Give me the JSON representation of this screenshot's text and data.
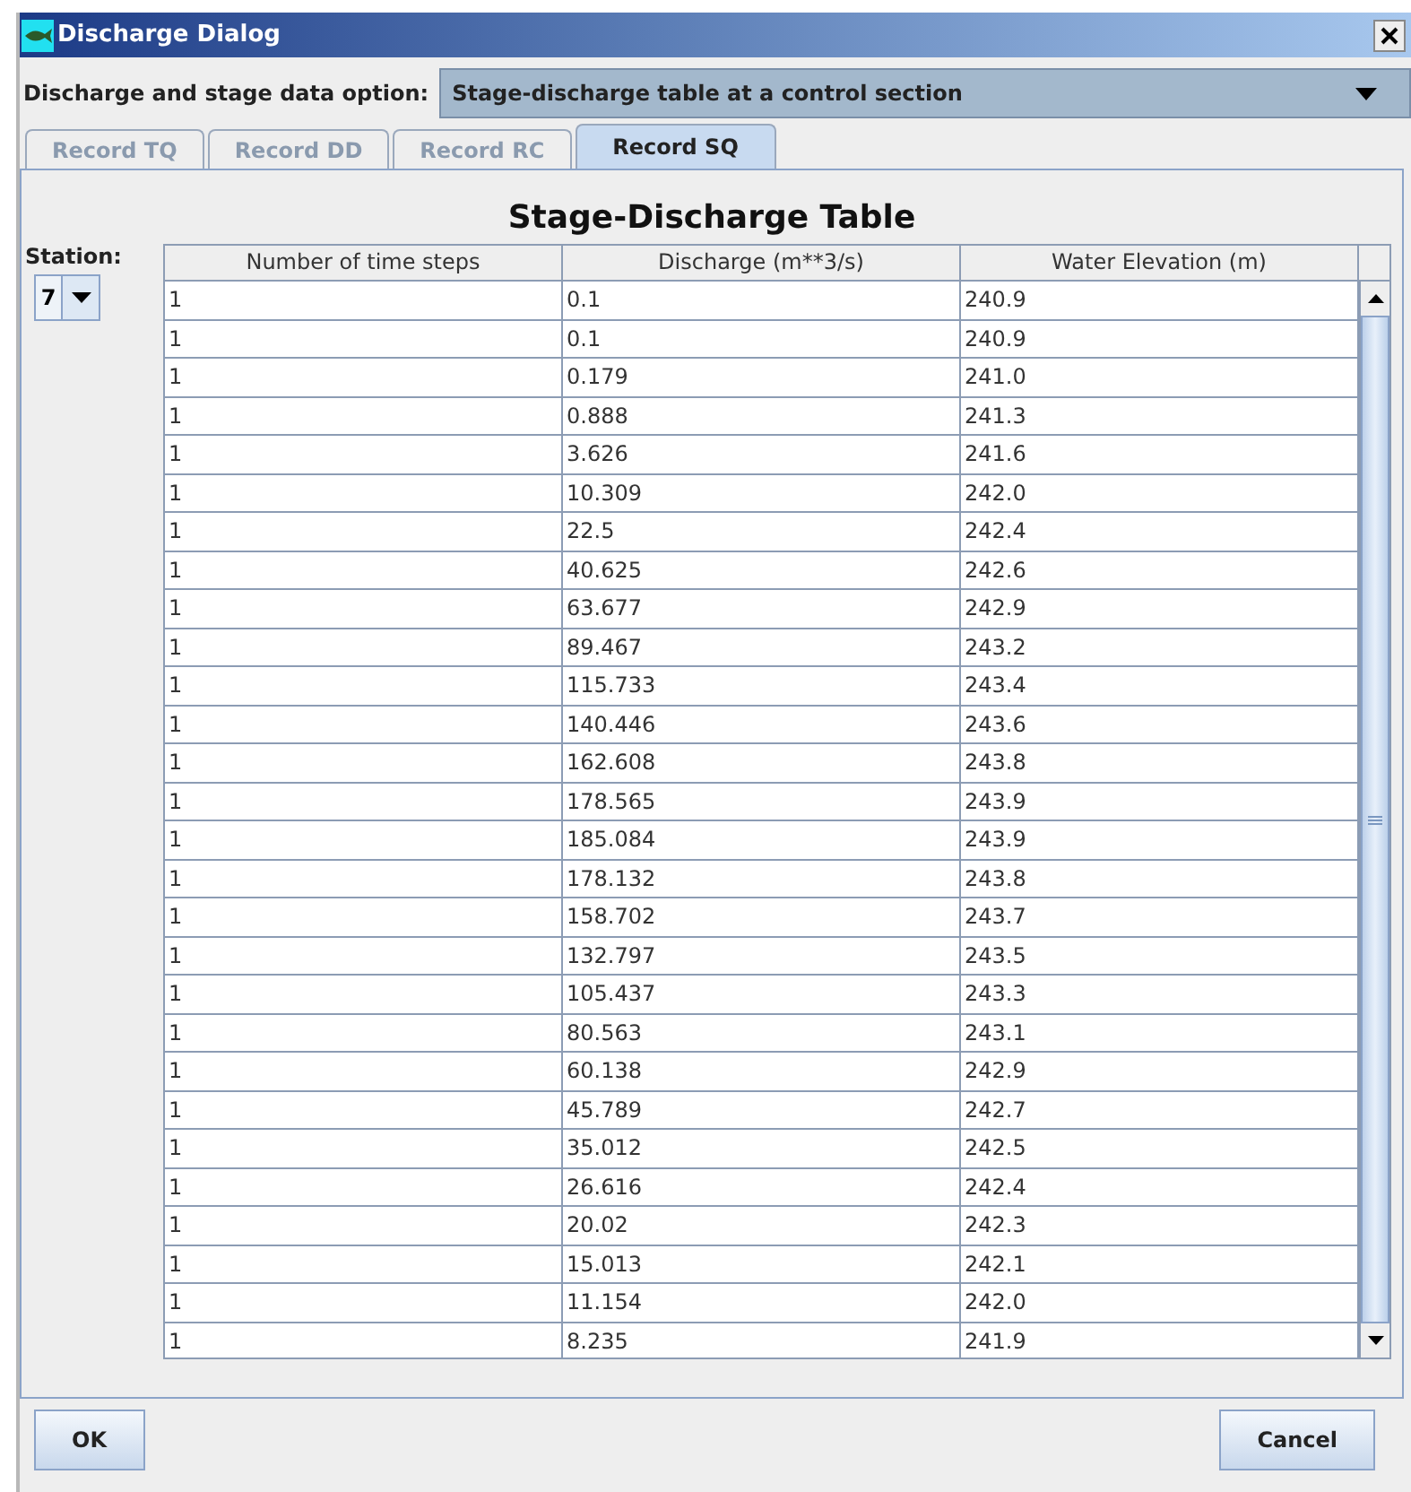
{
  "window": {
    "title": "Discharge Dialog"
  },
  "option": {
    "label": "Discharge and stage data option:",
    "value": "Stage-discharge table at a control section"
  },
  "tabs": [
    {
      "label": "Record TQ",
      "selected": false
    },
    {
      "label": "Record DD",
      "selected": false
    },
    {
      "label": "Record RC",
      "selected": false
    },
    {
      "label": "Record SQ",
      "selected": true
    }
  ],
  "panel_title": "Stage-Discharge Table",
  "station": {
    "label": "Station:",
    "value": "7"
  },
  "table": {
    "columns": [
      "Number of time steps",
      "Discharge (m**3/s)",
      "Water Elevation (m)"
    ],
    "rows": [
      [
        "1",
        "0.1",
        "240.9"
      ],
      [
        "1",
        "0.1",
        "240.9"
      ],
      [
        "1",
        "0.179",
        "241.0"
      ],
      [
        "1",
        "0.888",
        "241.3"
      ],
      [
        "1",
        "3.626",
        "241.6"
      ],
      [
        "1",
        "10.309",
        "242.0"
      ],
      [
        "1",
        "22.5",
        "242.4"
      ],
      [
        "1",
        "40.625",
        "242.6"
      ],
      [
        "1",
        "63.677",
        "242.9"
      ],
      [
        "1",
        "89.467",
        "243.2"
      ],
      [
        "1",
        "115.733",
        "243.4"
      ],
      [
        "1",
        "140.446",
        "243.6"
      ],
      [
        "1",
        "162.608",
        "243.8"
      ],
      [
        "1",
        "178.565",
        "243.9"
      ],
      [
        "1",
        "185.084",
        "243.9"
      ],
      [
        "1",
        "178.132",
        "243.8"
      ],
      [
        "1",
        "158.702",
        "243.7"
      ],
      [
        "1",
        "132.797",
        "243.5"
      ],
      [
        "1",
        "105.437",
        "243.3"
      ],
      [
        "1",
        "80.563",
        "243.1"
      ],
      [
        "1",
        "60.138",
        "242.9"
      ],
      [
        "1",
        "45.789",
        "242.7"
      ],
      [
        "1",
        "35.012",
        "242.5"
      ],
      [
        "1",
        "26.616",
        "242.4"
      ],
      [
        "1",
        "20.02",
        "242.3"
      ],
      [
        "1",
        "15.013",
        "242.1"
      ],
      [
        "1",
        "11.154",
        "242.0"
      ],
      [
        "1",
        "8.235",
        "241.9"
      ]
    ]
  },
  "buttons": [
    "OK",
    "Cancel"
  ]
}
